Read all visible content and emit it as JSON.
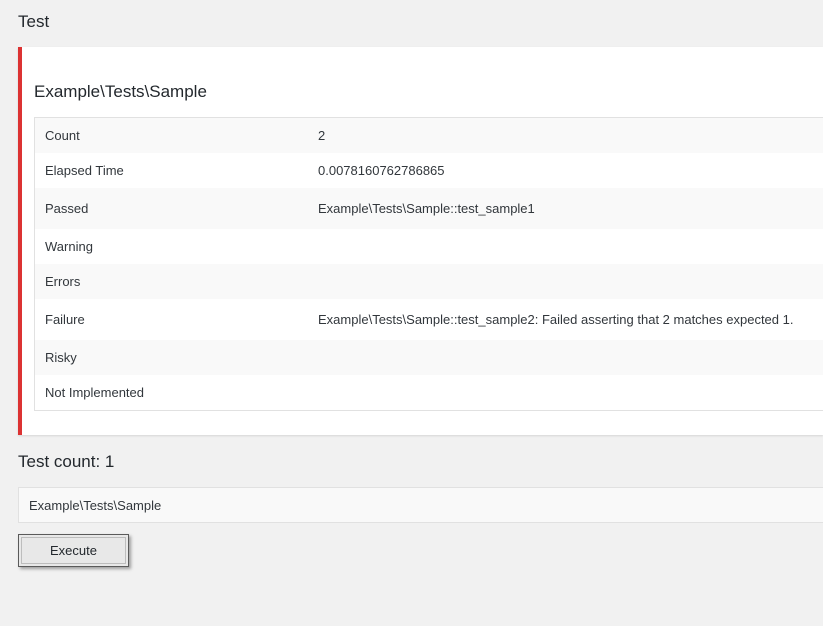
{
  "page": {
    "title": "Test"
  },
  "result": {
    "suite_name": "Example\\Tests\\Sample",
    "status_color": "#dc3232",
    "rows": [
      {
        "label": "Count",
        "value": "2"
      },
      {
        "label": "Elapsed Time",
        "value": "0.0078160762786865"
      },
      {
        "label": "Passed",
        "value": "Example\\Tests\\Sample::test_sample1"
      },
      {
        "label": "Warning",
        "value": ""
      },
      {
        "label": "Errors",
        "value": ""
      },
      {
        "label": "Failure",
        "value": "Example\\Tests\\Sample::test_sample2: Failed asserting that 2 matches expected 1."
      },
      {
        "label": "Risky",
        "value": ""
      },
      {
        "label": "Not Implemented",
        "value": ""
      }
    ]
  },
  "test_count": {
    "heading": "Test count: 1",
    "items": [
      "Example\\Tests\\Sample"
    ]
  },
  "actions": {
    "execute_label": "Execute"
  }
}
